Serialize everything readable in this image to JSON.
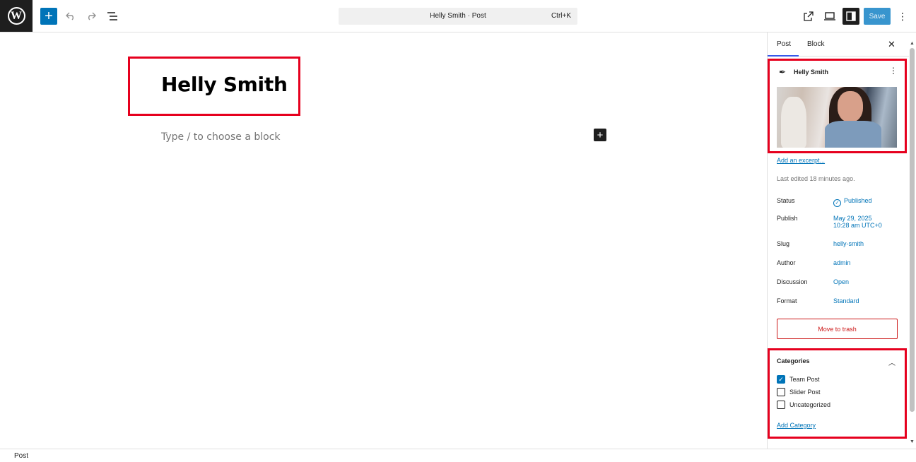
{
  "toolbar": {
    "logo": "W",
    "add_icon": "+",
    "command_title": "Helly Smith · Post",
    "command_shortcut": "Ctrl+K",
    "save_label": "Save",
    "more_icon": "⋮"
  },
  "editor": {
    "title": "Helly Smith",
    "placeholder": "Type / to choose a block",
    "inserter_icon": "+"
  },
  "sidebar": {
    "tabs": {
      "post": "Post",
      "block": "Block"
    },
    "close_icon": "✕",
    "post_card": {
      "name": "Helly Smith",
      "menu_icon": "⋮"
    },
    "excerpt_link": "Add an excerpt...",
    "last_edited": "Last edited 18 minutes ago.",
    "meta": [
      {
        "label": "Status",
        "value": "Published"
      },
      {
        "label": "Publish",
        "value": "May 29, 2025",
        "value2": "10:28 am UTC+0"
      },
      {
        "label": "Slug",
        "value": "helly-smith"
      },
      {
        "label": "Author",
        "value": "admin"
      },
      {
        "label": "Discussion",
        "value": "Open"
      },
      {
        "label": "Format",
        "value": "Standard"
      }
    ],
    "trash_label": "Move to trash",
    "categories": {
      "heading": "Categories",
      "items": [
        {
          "label": "Team Post",
          "checked": true
        },
        {
          "label": "Slider Post",
          "checked": false
        },
        {
          "label": "Uncategorized",
          "checked": false
        }
      ],
      "add_label": "Add Category"
    }
  },
  "statusbar": {
    "label": "Post"
  },
  "colors": {
    "accent": "#0074b8",
    "highlight": "#e6001e",
    "danger": "#cc1818"
  }
}
